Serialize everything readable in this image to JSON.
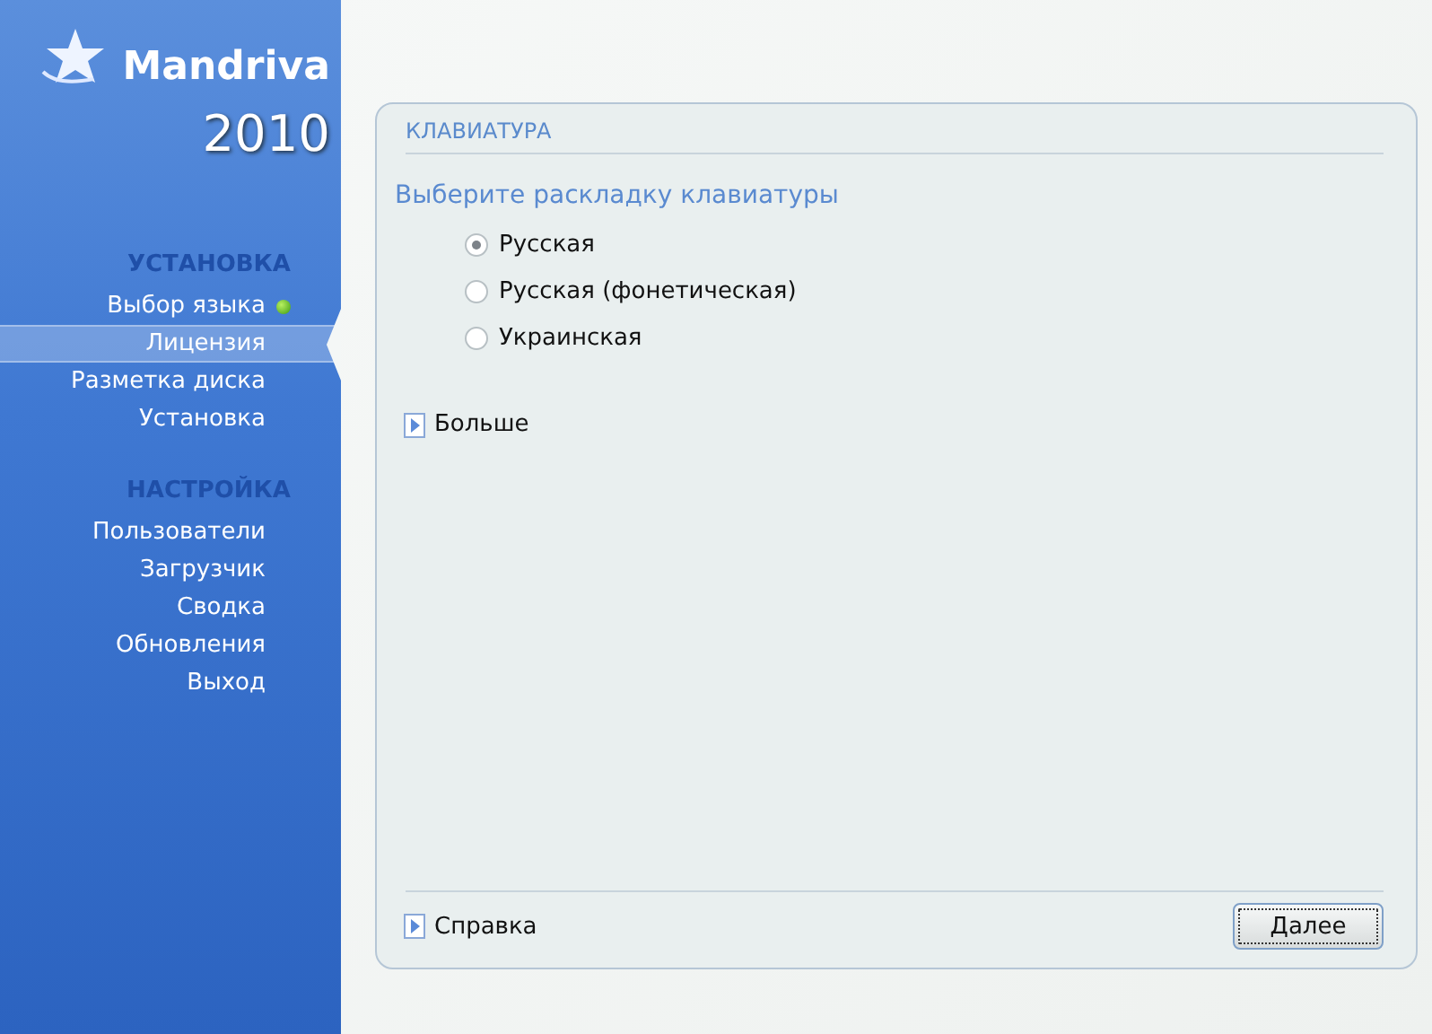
{
  "sidebar": {
    "logo": {
      "name": "Mandriva",
      "year": "2010"
    },
    "sections": [
      {
        "title": "УСТАНОВКА",
        "items": [
          {
            "label": "Выбор языка",
            "selected": false,
            "done": true
          },
          {
            "label": "Лицензия",
            "selected": true,
            "done": false
          },
          {
            "label": "Разметка диска",
            "selected": false,
            "done": false
          },
          {
            "label": "Установка",
            "selected": false,
            "done": false
          }
        ]
      },
      {
        "title": "НАСТРОЙКА",
        "items": [
          {
            "label": "Пользователи",
            "selected": false,
            "done": false
          },
          {
            "label": "Загрузчик",
            "selected": false,
            "done": false
          },
          {
            "label": "Сводка",
            "selected": false,
            "done": false
          },
          {
            "label": "Обновления",
            "selected": false,
            "done": false
          },
          {
            "label": "Выход",
            "selected": false,
            "done": false
          }
        ]
      }
    ]
  },
  "panel": {
    "title": "КЛАВИАТУРА",
    "prompt": "Выберите раскладку клавиатуры",
    "options": [
      {
        "label": "Русская",
        "selected": true
      },
      {
        "label": "Русская (фонетическая)",
        "selected": false
      },
      {
        "label": "Украинская",
        "selected": false
      }
    ],
    "more": "Больше",
    "help": "Справка",
    "next_button": "Далее"
  }
}
